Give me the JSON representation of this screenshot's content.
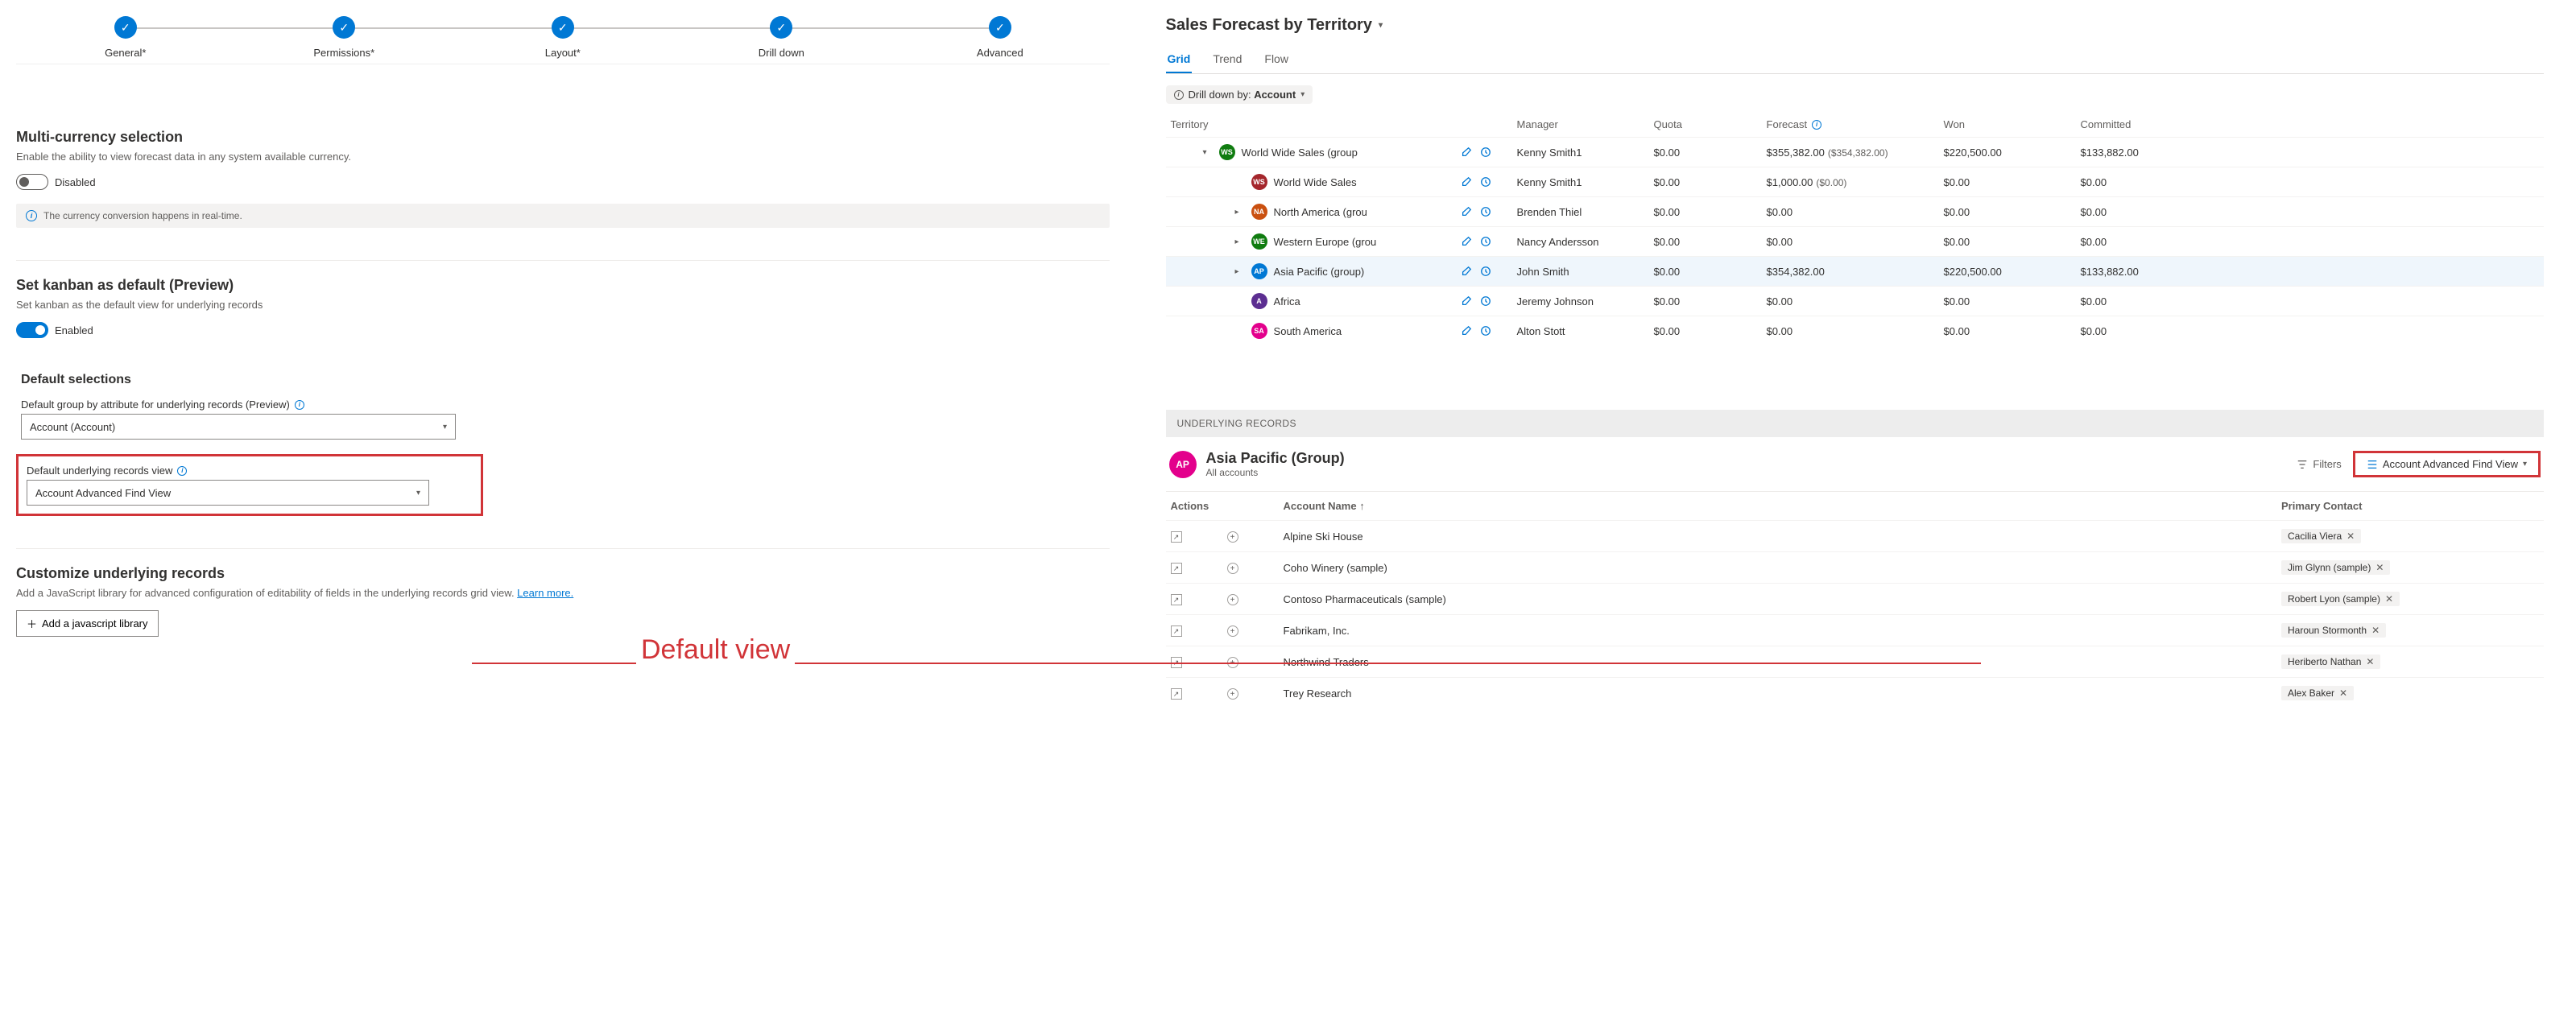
{
  "stepper": {
    "steps": [
      {
        "label": "General*"
      },
      {
        "label": "Permissions*"
      },
      {
        "label": "Layout*"
      },
      {
        "label": "Drill down"
      },
      {
        "label": "Advanced"
      }
    ]
  },
  "multi_currency": {
    "title": "Multi-currency selection",
    "desc": "Enable the ability to view forecast data in any system available currency.",
    "toggle_label": "Disabled",
    "banner": "The currency conversion happens in real-time."
  },
  "kanban": {
    "title": "Set kanban as default (Preview)",
    "desc": "Set kanban as the default view for underlying records",
    "toggle_label": "Enabled"
  },
  "defaults": {
    "title": "Default selections",
    "group_label": "Default group by attribute for underlying records (Preview)",
    "group_value": "Account (Account)",
    "view_label": "Default underlying records view",
    "view_value": "Account Advanced Find View"
  },
  "customize": {
    "title": "Customize underlying records",
    "desc_a": "Add a JavaScript library for advanced configuration of editability of fields in the underlying records grid view. ",
    "learn": "Learn more.",
    "button": "Add a javascript library"
  },
  "annotation": "Default view",
  "forecast": {
    "title": "Sales Forecast by Territory",
    "tabs": [
      "Grid",
      "Trend",
      "Flow"
    ],
    "drill_prefix": "Drill down by: ",
    "drill_value": "Account",
    "headers": {
      "territory": "Territory",
      "manager": "Manager",
      "quota": "Quota",
      "forecast": "Forecast",
      "won": "Won",
      "committed": "Committed"
    },
    "rows": [
      {
        "name": "World Wide Sales (group",
        "indent": 1,
        "avatar": "WS",
        "color": "#107c10",
        "caret": "down",
        "manager": "Kenny Smith1",
        "quota": "$0.00",
        "forecast": "$355,382.00",
        "adj": "($354,382.00)",
        "won": "$220,500.00",
        "committed": "$133,882.00"
      },
      {
        "name": "World Wide Sales",
        "indent": 2,
        "avatar": "WS",
        "color": "#a4262c",
        "caret": "",
        "manager": "Kenny Smith1",
        "quota": "$0.00",
        "forecast": "$1,000.00",
        "adj": "($0.00)",
        "won": "$0.00",
        "committed": "$0.00"
      },
      {
        "name": "North America (grou",
        "indent": 2,
        "avatar": "NA",
        "color": "#ca5010",
        "caret": "right",
        "manager": "Brenden Thiel",
        "quota": "$0.00",
        "forecast": "$0.00",
        "adj": "",
        "won": "$0.00",
        "committed": "$0.00"
      },
      {
        "name": "Western Europe (grou",
        "indent": 2,
        "avatar": "WE",
        "color": "#107c10",
        "caret": "right",
        "manager": "Nancy Andersson",
        "quota": "$0.00",
        "forecast": "$0.00",
        "adj": "",
        "won": "$0.00",
        "committed": "$0.00"
      },
      {
        "name": "Asia Pacific (group)",
        "indent": 2,
        "avatar": "AP",
        "color": "#0078d4",
        "caret": "right",
        "hl": true,
        "manager": "John Smith",
        "quota": "$0.00",
        "forecast": "$354,382.00",
        "adj": "",
        "won": "$220,500.00",
        "committed": "$133,882.00"
      },
      {
        "name": "Africa",
        "indent": 2,
        "avatar": "A",
        "color": "#5c2e91",
        "caret": "",
        "manager": "Jeremy Johnson",
        "quota": "$0.00",
        "forecast": "$0.00",
        "adj": "",
        "won": "$0.00",
        "committed": "$0.00"
      },
      {
        "name": "South America",
        "indent": 2,
        "avatar": "SA",
        "color": "#e3008c",
        "caret": "",
        "manager": "Alton Stott",
        "quota": "$0.00",
        "forecast": "$0.00",
        "adj": "",
        "won": "$0.00",
        "committed": "$0.00"
      }
    ]
  },
  "underlying": {
    "bar": "UNDERLYING RECORDS",
    "avatar": "AP",
    "title": "Asia Pacific (Group)",
    "sub": "All accounts",
    "filters": "Filters",
    "view": "Account Advanced Find View",
    "headers": {
      "actions": "Actions",
      "name": "Account Name",
      "contact": "Primary Contact"
    },
    "rows": [
      {
        "name": "Alpine Ski House",
        "contact": "Cacilia Viera"
      },
      {
        "name": "Coho Winery (sample)",
        "contact": "Jim Glynn (sample)"
      },
      {
        "name": "Contoso Pharmaceuticals (sample)",
        "contact": "Robert Lyon (sample)"
      },
      {
        "name": "Fabrikam, Inc.",
        "contact": "Haroun Stormonth"
      },
      {
        "name": "Northwind Traders",
        "contact": "Heriberto Nathan"
      },
      {
        "name": "Trey Research",
        "contact": "Alex Baker"
      }
    ]
  }
}
